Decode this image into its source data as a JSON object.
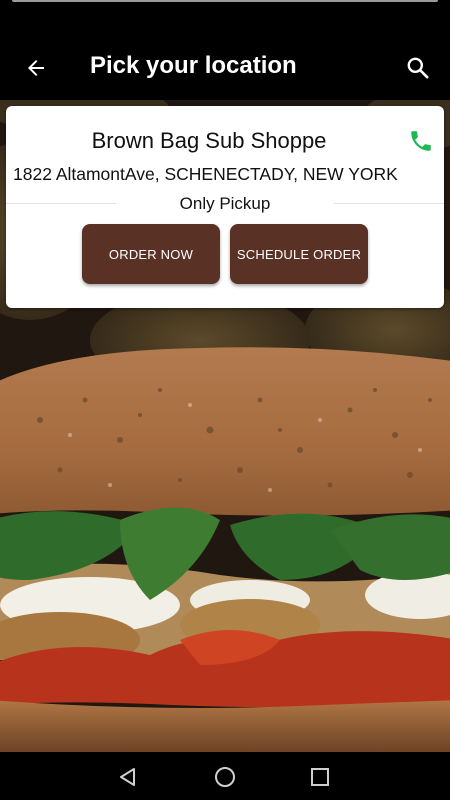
{
  "app_bar": {
    "title": "Pick your location",
    "back_icon": "arrow-left-icon",
    "search_icon": "search-icon"
  },
  "location": {
    "name": "Brown Bag Sub Shoppe",
    "address": "1822 AltamontAve, SCHENECTADY, NEW YORK",
    "service_mode": "Only Pickup",
    "order_now_label": "ORDER NOW",
    "schedule_order_label": "SCHEDULE ORDER",
    "phone_icon": "phone-icon"
  },
  "colors": {
    "button_bg": "#5a3125",
    "phone_icon": "#1db954",
    "app_bar_bg": "#000000"
  },
  "nav_bar": {
    "icons": [
      "back-triangle-icon",
      "home-circle-icon",
      "recents-square-icon"
    ]
  }
}
